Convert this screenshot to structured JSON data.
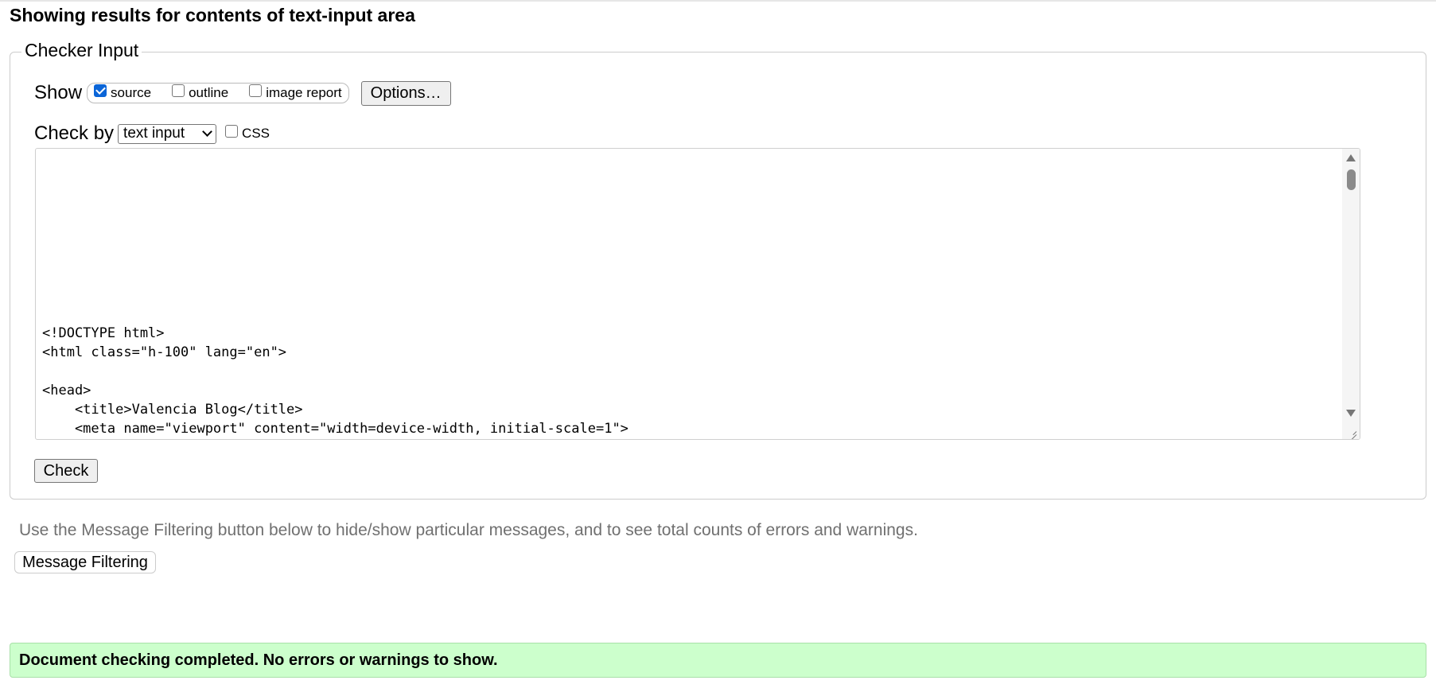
{
  "header": {
    "title": "Showing results for contents of text-input area"
  },
  "checker_input": {
    "legend": "Checker Input",
    "show": {
      "label": "Show",
      "options": [
        {
          "label": "source",
          "checked": true
        },
        {
          "label": "outline",
          "checked": false
        },
        {
          "label": "image report",
          "checked": false
        }
      ],
      "options_button": "Options…"
    },
    "check_by": {
      "label": "Check by",
      "selected": "text input",
      "css_label": "CSS",
      "css_checked": false
    },
    "textarea": {
      "lines": [
        "<!DOCTYPE html>",
        "<html class=\"h-100\" lang=\"en\">",
        "",
        "<head>",
        "    <title>Valencia Blog</title>",
        "    <meta name=\"viewport\" content=\"width=device-width, initial-scale=1\">"
      ]
    },
    "check_button": "Check"
  },
  "filtering": {
    "note": "Use the Message Filtering button below to hide/show particular messages, and to see total counts of errors and warnings.",
    "button": "Message Filtering"
  },
  "result": {
    "message": "Document checking completed. No errors or warnings to show.",
    "color": "#ccffcc"
  },
  "icons": {
    "checkbox_checked_color": "#0a65d8",
    "select": "chevron-down-icon",
    "scroll_up": "arrow-up-icon",
    "scroll_down": "arrow-down-icon",
    "resize": "resize-grip-icon"
  }
}
